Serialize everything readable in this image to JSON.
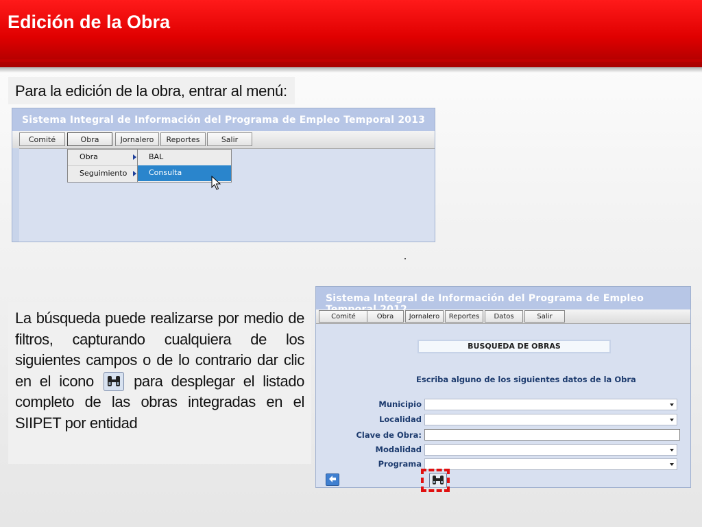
{
  "slide": {
    "title": "Edición de la Obra",
    "intro_text": "Para la edición de la obra, entrar al menú:",
    "desc_part1": "La búsqueda puede realizarse por medio de filtros, capturando cualquiera de los siguientes campos o de lo contrario dar clic en el icono",
    "desc_part2": "para desplegar el listado completo de las obras integradas en el SIIPET por entidad"
  },
  "shot1": {
    "app_title": "Sistema Integral de Información del Programa de Empleo Temporal 2013",
    "menu": [
      "Comité",
      "Obra",
      "Jornalero",
      "Reportes",
      "Salir"
    ],
    "dropdown": [
      "Obra",
      "Seguimiento"
    ],
    "submenu": [
      "BAL",
      "Consulta"
    ],
    "active_submenu": "Consulta"
  },
  "shot2": {
    "app_title": "Sistema Integral de Información del Programa de Empleo Temporal 2012",
    "menu": [
      "Comité",
      "Obra",
      "Jornalero",
      "Reportes",
      "Datos",
      "Salir"
    ],
    "search_title": "BUSQUEDA DE OBRAS",
    "instruction": "Escriba alguno de los siguientes datos de la Obra",
    "fields": [
      {
        "label": "Municipio",
        "type": "select"
      },
      {
        "label": "Localidad",
        "type": "select"
      },
      {
        "label": "Clave de Obra:",
        "type": "text"
      },
      {
        "label": "Modalidad",
        "type": "select"
      },
      {
        "label": "Programa",
        "type": "select"
      }
    ]
  },
  "colors": {
    "header_red": "#e00000",
    "app_bar_blue": "#b7c6e6",
    "highlight_blue": "#2a85cc",
    "dashed_red": "#e01010"
  },
  "icons": [
    "binoculars-icon",
    "back-arrow-icon",
    "submenu-arrow-icon",
    "mouse-pointer-icon",
    "dropdown-arrow-icon"
  ]
}
